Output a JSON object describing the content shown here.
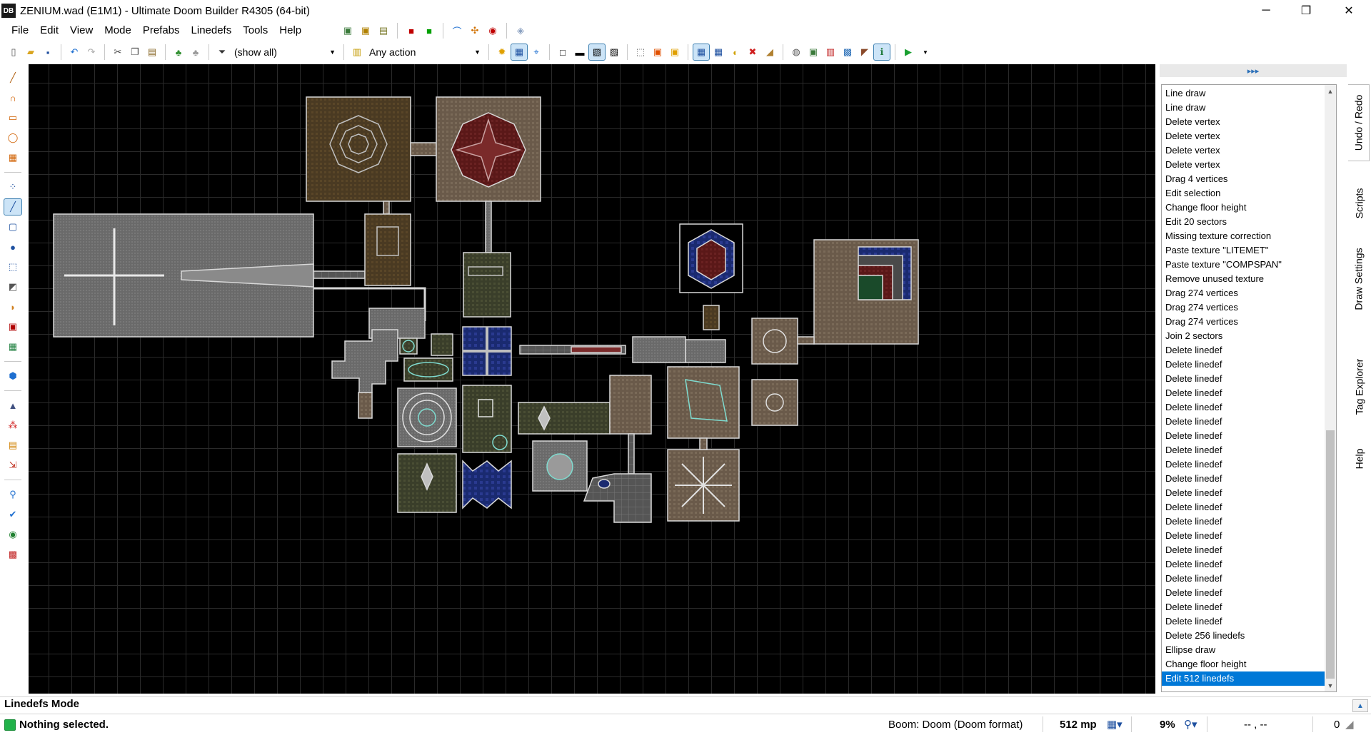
{
  "window": {
    "title": "ZENIUM.wad (E1M1) - Ultimate Doom Builder R4305 (64-bit)",
    "icon_text": "DB",
    "minimize_glyph": "─",
    "maximize_glyph": "❐",
    "close_glyph": "✕"
  },
  "menu": [
    "File",
    "Edit",
    "View",
    "Mode",
    "Prefabs",
    "Linedefs",
    "Tools",
    "Help"
  ],
  "toolbar": {
    "filter_value": "(show all)",
    "action_value": "Any action"
  },
  "side_panel": {
    "expand_glyph": "▸▸▸",
    "history": [
      "Line draw",
      "Line draw",
      "Delete vertex",
      "Delete vertex",
      "Delete vertex",
      "Delete vertex",
      "Drag 4 vertices",
      "Edit selection",
      "Change floor height",
      "Edit 20 sectors",
      "Missing texture correction",
      "Paste texture \"LITEMET\"",
      "Paste texture \"COMPSPAN\"",
      "Remove unused texture",
      "Drag 274 vertices",
      "Drag 274 vertices",
      "Drag 274 vertices",
      "Join 2 sectors",
      "Delete linedef",
      "Delete linedef",
      "Delete linedef",
      "Delete linedef",
      "Delete linedef",
      "Delete linedef",
      "Delete linedef",
      "Delete linedef",
      "Delete linedef",
      "Delete linedef",
      "Delete linedef",
      "Delete linedef",
      "Delete linedef",
      "Delete linedef",
      "Delete linedef",
      "Delete linedef",
      "Delete linedef",
      "Delete linedef",
      "Delete linedef",
      "Delete linedef",
      "Delete 256 linedefs",
      "Ellipse draw",
      "Change floor height",
      "Edit 512 linedefs"
    ],
    "selected_index": 41,
    "tabs": [
      "Undo / Redo",
      "Scripts",
      "Draw Settings",
      "Tag Explorer",
      "Help"
    ]
  },
  "status": {
    "mode_label": "Linedefs Mode",
    "selection_text": "Nothing selected.",
    "game_config": "Boom: Doom (Doom format)",
    "grid_size": "512 mp",
    "zoom": "9%",
    "coordinates": "-- , --",
    "thing_count": "0",
    "led_color": "#21b24a"
  },
  "colors": {
    "selection": "#0078d7",
    "map_background": "#000000",
    "line_color": "#d8d8d8"
  }
}
